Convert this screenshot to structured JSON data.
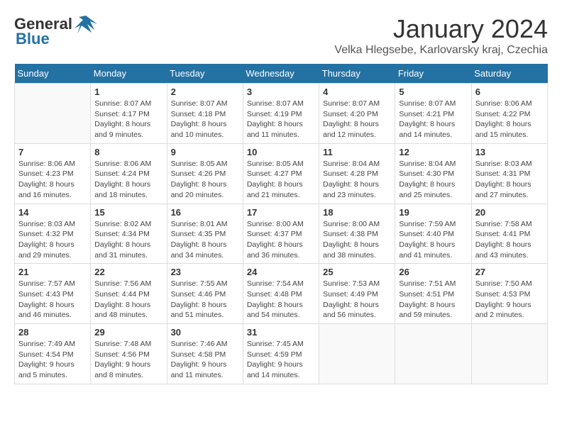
{
  "header": {
    "logo_general": "General",
    "logo_blue": "Blue",
    "month": "January 2024",
    "location": "Velka Hlegsebe, Karlovarsky kraj, Czechia"
  },
  "weekdays": [
    "Sunday",
    "Monday",
    "Tuesday",
    "Wednesday",
    "Thursday",
    "Friday",
    "Saturday"
  ],
  "weeks": [
    [
      {
        "day": "",
        "sunrise": "",
        "sunset": "",
        "daylight": ""
      },
      {
        "day": "1",
        "sunrise": "Sunrise: 8:07 AM",
        "sunset": "Sunset: 4:17 PM",
        "daylight": "Daylight: 8 hours and 9 minutes."
      },
      {
        "day": "2",
        "sunrise": "Sunrise: 8:07 AM",
        "sunset": "Sunset: 4:18 PM",
        "daylight": "Daylight: 8 hours and 10 minutes."
      },
      {
        "day": "3",
        "sunrise": "Sunrise: 8:07 AM",
        "sunset": "Sunset: 4:19 PM",
        "daylight": "Daylight: 8 hours and 11 minutes."
      },
      {
        "day": "4",
        "sunrise": "Sunrise: 8:07 AM",
        "sunset": "Sunset: 4:20 PM",
        "daylight": "Daylight: 8 hours and 12 minutes."
      },
      {
        "day": "5",
        "sunrise": "Sunrise: 8:07 AM",
        "sunset": "Sunset: 4:21 PM",
        "daylight": "Daylight: 8 hours and 14 minutes."
      },
      {
        "day": "6",
        "sunrise": "Sunrise: 8:06 AM",
        "sunset": "Sunset: 4:22 PM",
        "daylight": "Daylight: 8 hours and 15 minutes."
      }
    ],
    [
      {
        "day": "7",
        "sunrise": "Sunrise: 8:06 AM",
        "sunset": "Sunset: 4:23 PM",
        "daylight": "Daylight: 8 hours and 16 minutes."
      },
      {
        "day": "8",
        "sunrise": "Sunrise: 8:06 AM",
        "sunset": "Sunset: 4:24 PM",
        "daylight": "Daylight: 8 hours and 18 minutes."
      },
      {
        "day": "9",
        "sunrise": "Sunrise: 8:05 AM",
        "sunset": "Sunset: 4:26 PM",
        "daylight": "Daylight: 8 hours and 20 minutes."
      },
      {
        "day": "10",
        "sunrise": "Sunrise: 8:05 AM",
        "sunset": "Sunset: 4:27 PM",
        "daylight": "Daylight: 8 hours and 21 minutes."
      },
      {
        "day": "11",
        "sunrise": "Sunrise: 8:04 AM",
        "sunset": "Sunset: 4:28 PM",
        "daylight": "Daylight: 8 hours and 23 minutes."
      },
      {
        "day": "12",
        "sunrise": "Sunrise: 8:04 AM",
        "sunset": "Sunset: 4:30 PM",
        "daylight": "Daylight: 8 hours and 25 minutes."
      },
      {
        "day": "13",
        "sunrise": "Sunrise: 8:03 AM",
        "sunset": "Sunset: 4:31 PM",
        "daylight": "Daylight: 8 hours and 27 minutes."
      }
    ],
    [
      {
        "day": "14",
        "sunrise": "Sunrise: 8:03 AM",
        "sunset": "Sunset: 4:32 PM",
        "daylight": "Daylight: 8 hours and 29 minutes."
      },
      {
        "day": "15",
        "sunrise": "Sunrise: 8:02 AM",
        "sunset": "Sunset: 4:34 PM",
        "daylight": "Daylight: 8 hours and 31 minutes."
      },
      {
        "day": "16",
        "sunrise": "Sunrise: 8:01 AM",
        "sunset": "Sunset: 4:35 PM",
        "daylight": "Daylight: 8 hours and 34 minutes."
      },
      {
        "day": "17",
        "sunrise": "Sunrise: 8:00 AM",
        "sunset": "Sunset: 4:37 PM",
        "daylight": "Daylight: 8 hours and 36 minutes."
      },
      {
        "day": "18",
        "sunrise": "Sunrise: 8:00 AM",
        "sunset": "Sunset: 4:38 PM",
        "daylight": "Daylight: 8 hours and 38 minutes."
      },
      {
        "day": "19",
        "sunrise": "Sunrise: 7:59 AM",
        "sunset": "Sunset: 4:40 PM",
        "daylight": "Daylight: 8 hours and 41 minutes."
      },
      {
        "day": "20",
        "sunrise": "Sunrise: 7:58 AM",
        "sunset": "Sunset: 4:41 PM",
        "daylight": "Daylight: 8 hours and 43 minutes."
      }
    ],
    [
      {
        "day": "21",
        "sunrise": "Sunrise: 7:57 AM",
        "sunset": "Sunset: 4:43 PM",
        "daylight": "Daylight: 8 hours and 46 minutes."
      },
      {
        "day": "22",
        "sunrise": "Sunrise: 7:56 AM",
        "sunset": "Sunset: 4:44 PM",
        "daylight": "Daylight: 8 hours and 48 minutes."
      },
      {
        "day": "23",
        "sunrise": "Sunrise: 7:55 AM",
        "sunset": "Sunset: 4:46 PM",
        "daylight": "Daylight: 8 hours and 51 minutes."
      },
      {
        "day": "24",
        "sunrise": "Sunrise: 7:54 AM",
        "sunset": "Sunset: 4:48 PM",
        "daylight": "Daylight: 8 hours and 54 minutes."
      },
      {
        "day": "25",
        "sunrise": "Sunrise: 7:53 AM",
        "sunset": "Sunset: 4:49 PM",
        "daylight": "Daylight: 8 hours and 56 minutes."
      },
      {
        "day": "26",
        "sunrise": "Sunrise: 7:51 AM",
        "sunset": "Sunset: 4:51 PM",
        "daylight": "Daylight: 8 hours and 59 minutes."
      },
      {
        "day": "27",
        "sunrise": "Sunrise: 7:50 AM",
        "sunset": "Sunset: 4:53 PM",
        "daylight": "Daylight: 9 hours and 2 minutes."
      }
    ],
    [
      {
        "day": "28",
        "sunrise": "Sunrise: 7:49 AM",
        "sunset": "Sunset: 4:54 PM",
        "daylight": "Daylight: 9 hours and 5 minutes."
      },
      {
        "day": "29",
        "sunrise": "Sunrise: 7:48 AM",
        "sunset": "Sunset: 4:56 PM",
        "daylight": "Daylight: 9 hours and 8 minutes."
      },
      {
        "day": "30",
        "sunrise": "Sunrise: 7:46 AM",
        "sunset": "Sunset: 4:58 PM",
        "daylight": "Daylight: 9 hours and 11 minutes."
      },
      {
        "day": "31",
        "sunrise": "Sunrise: 7:45 AM",
        "sunset": "Sunset: 4:59 PM",
        "daylight": "Daylight: 9 hours and 14 minutes."
      },
      {
        "day": "",
        "sunrise": "",
        "sunset": "",
        "daylight": ""
      },
      {
        "day": "",
        "sunrise": "",
        "sunset": "",
        "daylight": ""
      },
      {
        "day": "",
        "sunrise": "",
        "sunset": "",
        "daylight": ""
      }
    ]
  ]
}
